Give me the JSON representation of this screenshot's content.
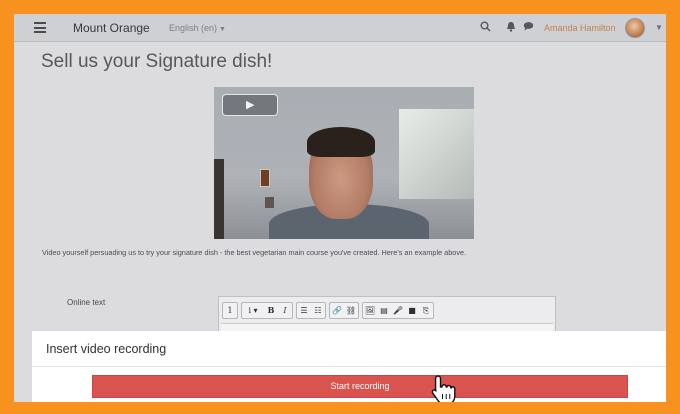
{
  "navbar": {
    "site_name": "Mount Orange",
    "language": "English (en)",
    "user_name": "Amanda Hamilton"
  },
  "page": {
    "title": "Sell us your Signature dish!",
    "description": "Video yourself persuading us to try your signature dish - the best vegetarian main course you've created. Here's an example above."
  },
  "video": {
    "play_glyph": "▶"
  },
  "form": {
    "online_text_label": "Online text"
  },
  "toolbar": {
    "items": [
      "1",
      "i ▾",
      "B",
      "I",
      "☰",
      "☷",
      "🔗",
      "⛓",
      "🖼",
      "▤",
      "🎤",
      "■",
      "⎘"
    ]
  },
  "modal": {
    "title": "Insert video recording",
    "close_label": "×",
    "start_button": "Start recording"
  },
  "colors": {
    "frame_border": "#f7921e",
    "start_button": "#d9534f",
    "user_link": "#c0824e"
  }
}
